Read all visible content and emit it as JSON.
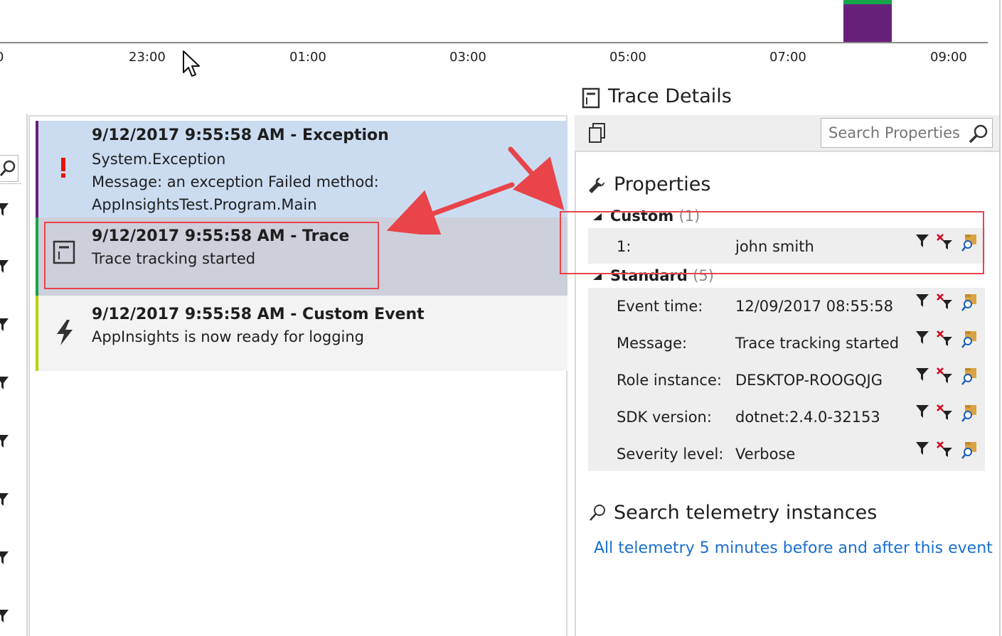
{
  "timeline": {
    "ticks": [
      "0",
      "23:00",
      "01:00",
      "03:00",
      "05:00",
      "07:00",
      "09:00"
    ]
  },
  "events": [
    {
      "title": "9/12/2017 9:55:58 AM - Exception",
      "lines": [
        "System.Exception",
        "Message: an exception  Failed method:",
        "AppInsightsTest.Program.Main"
      ],
      "icon": "exception-icon",
      "stripe_color": "#68217a",
      "bg": "#cbdcf1"
    },
    {
      "title": "9/12/2017 9:55:58 AM - Trace",
      "lines": [
        "Trace tracking started"
      ],
      "icon": "trace-icon",
      "stripe_color": "#16a34a",
      "bg": "#cdcfdb"
    },
    {
      "title": "9/12/2017 9:55:58 AM - Custom Event",
      "lines": [
        "AppInsights is now ready for logging"
      ],
      "icon": "custom-event-icon",
      "stripe_color": "#bcd000",
      "bg": "#f3f3f3"
    }
  ],
  "details": {
    "title": "Trace Details",
    "search_placeholder": "Search Properties",
    "properties_title": "Properties",
    "custom": {
      "label": "Custom",
      "count": "(1)",
      "rows": [
        {
          "label": "1:",
          "value": "john smith"
        }
      ]
    },
    "standard": {
      "label": "Standard",
      "count": "(5)",
      "rows": [
        {
          "label": "Event time:",
          "value": "12/09/2017 08:55:58"
        },
        {
          "label": "Message:",
          "value": "Trace tracking started"
        },
        {
          "label": "Role instance:",
          "value": "DESKTOP-ROOGQJG"
        },
        {
          "label": "SDK version:",
          "value": "dotnet:2.4.0-32153"
        },
        {
          "label": "Severity level:",
          "value": "Verbose"
        }
      ]
    },
    "search_telemetry_title": "Search telemetry instances",
    "search_telemetry_link": "All telemetry 5 minutes before and after this event"
  },
  "colors": {
    "accent_link": "#1a6fd1",
    "annotation": "#e8444a",
    "timeline_bar": "#68217a"
  }
}
